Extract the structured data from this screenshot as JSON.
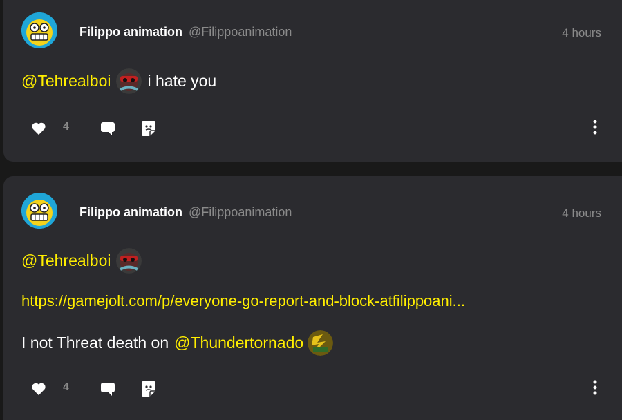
{
  "posts": [
    {
      "display_name": "Filippo animation",
      "username": "@Filippoanimation",
      "timestamp": "4 hours",
      "mention": "@Tehrealboi",
      "text": "i hate you",
      "like_count": "4"
    },
    {
      "display_name": "Filippo animation",
      "username": "@Filippoanimation",
      "timestamp": "4 hours",
      "mention": "@Tehrealboi",
      "link": "https://gamejolt.com/p/everyone-go-report-and-block-atfilippoani...",
      "text_prefix": "I not Threat death on",
      "mention2": "@Thundertornado",
      "like_count": "4"
    }
  ],
  "icons": {
    "like": "heart-icon",
    "comment": "comment-bubble-icon",
    "share": "share-sticker-icon",
    "more": "more-vertical-icon"
  },
  "colors": {
    "background": "#191919",
    "card": "#2b2b2f",
    "mention": "#ffee00",
    "muted": "#8a8a8a"
  }
}
